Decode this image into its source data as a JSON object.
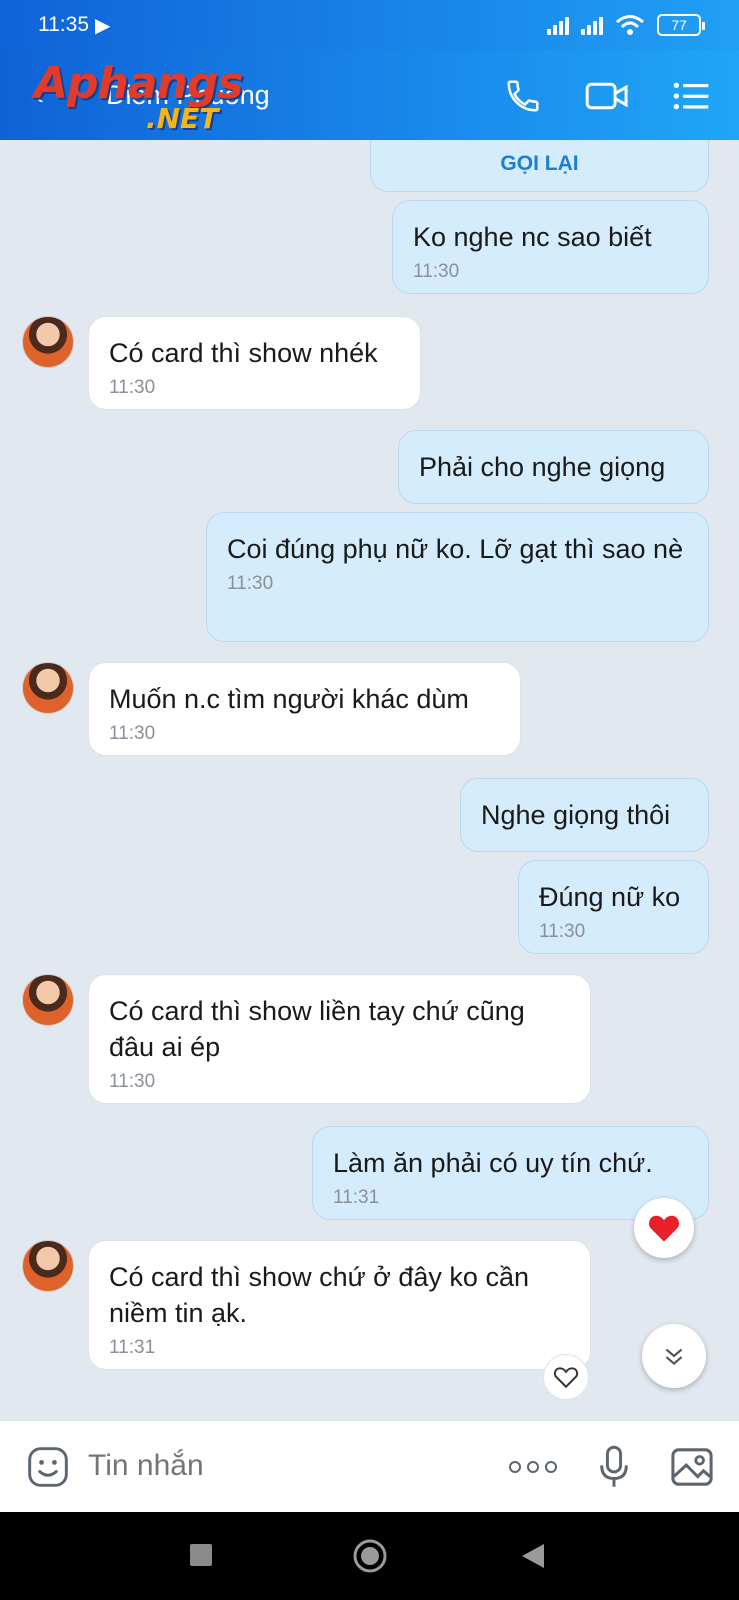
{
  "status_bar": {
    "time": "11:35",
    "battery": "77"
  },
  "header": {
    "contact_name": "Diem Phuong",
    "watermark_main": "Aphangs",
    "watermark_sub": ".NET"
  },
  "callback_label": "GỌI LẠI",
  "messages": [
    {
      "dir": "out",
      "text": "Ko nghe nc sao biết",
      "time": "11:30"
    },
    {
      "dir": "in",
      "text": "Có card thì show nhék",
      "time": "11:30"
    },
    {
      "dir": "out",
      "text": "Phải cho nghe giọng",
      "time": ""
    },
    {
      "dir": "out",
      "text": "Coi đúng phụ nữ ko. Lỡ gạt thì sao nè",
      "time": "11:30"
    },
    {
      "dir": "in",
      "text": "Muốn n.c tìm người khác dùm",
      "time": "11:30"
    },
    {
      "dir": "out",
      "text": "Nghe giọng thôi",
      "time": ""
    },
    {
      "dir": "out",
      "text": "Đúng nữ ko",
      "time": "11:30"
    },
    {
      "dir": "in",
      "text": "Có card thì show liền tay chứ cũng đâu ai ép",
      "time": "11:30"
    },
    {
      "dir": "out",
      "text": "Làm ăn phải có uy tín chứ.",
      "time": "11:31"
    },
    {
      "dir": "in",
      "text": "Có card thì show chứ ở đây ko cần niềm tin ạk.",
      "time": "11:31"
    }
  ],
  "input": {
    "placeholder": "Tin nhắn"
  },
  "colors": {
    "accent": "#1a86ea",
    "outgoing_bubble": "#d5ecfd",
    "incoming_bubble": "#ffffff",
    "heart": "#e8202a"
  },
  "icons": [
    "phone-icon",
    "video-call-icon",
    "menu-list-icon",
    "sticker-icon",
    "more-icon",
    "microphone-icon",
    "image-icon",
    "heart-icon",
    "scroll-down-icon"
  ]
}
